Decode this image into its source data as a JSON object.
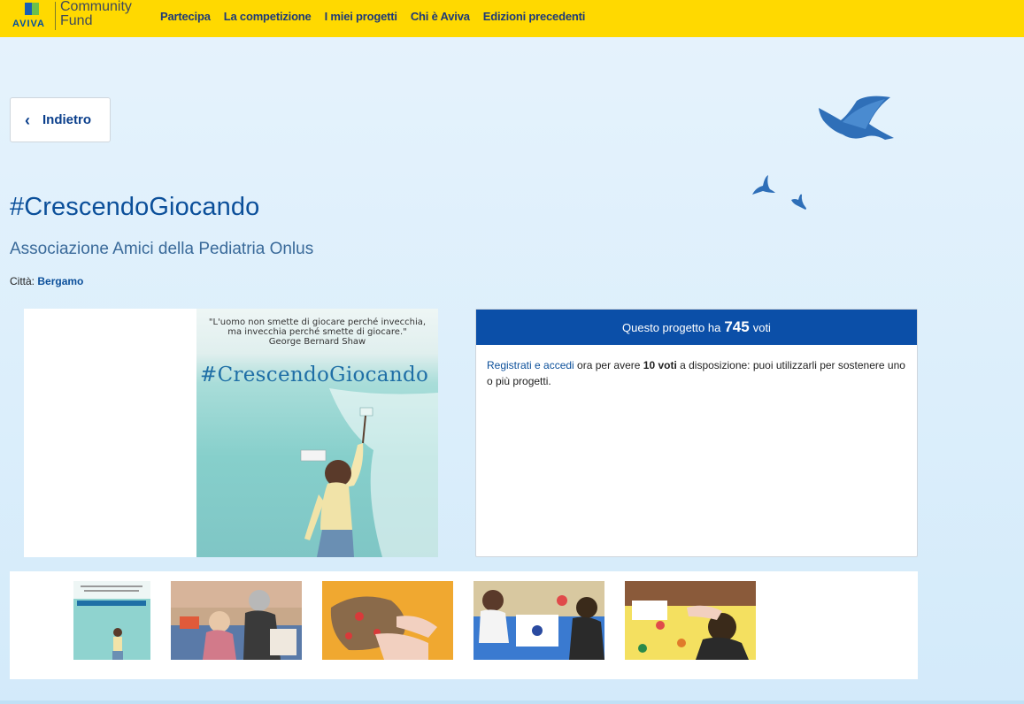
{
  "header": {
    "logo_brand": "AVIVA",
    "logo_line1": "Community",
    "logo_line2": "Fund",
    "nav": [
      "Partecipa",
      "La competizione",
      "I miei progetti",
      "Chi è Aviva",
      "Edizioni precedenti"
    ]
  },
  "back_button": {
    "label": "Indietro"
  },
  "project": {
    "title": "#CrescendoGiocando",
    "organization": "Associazione Amici della Pediatria Onlus",
    "city_label": "Città:",
    "city": "Bergamo"
  },
  "poster": {
    "quote_line1": "\"L'uomo non smette di giocare perché invecchia,",
    "quote_line2": "ma invecchia perché smette di giocare.\"",
    "quote_author": "George Bernard Shaw",
    "title": "#CrescendoGiocando"
  },
  "votes": {
    "prefix": "Questo progetto ha",
    "count": "745",
    "suffix": "voti",
    "login_link": "Registrati e accedi",
    "text1": " ora per avere ",
    "votes_available": "10 voti",
    "text2": " a disposizione: puoi utilizzarli per sostenere uno o più progetti."
  },
  "colors": {
    "header_yellow": "#ffd900",
    "brand_blue": "#0b4fa8",
    "title_blue": "#0b4f9a"
  }
}
